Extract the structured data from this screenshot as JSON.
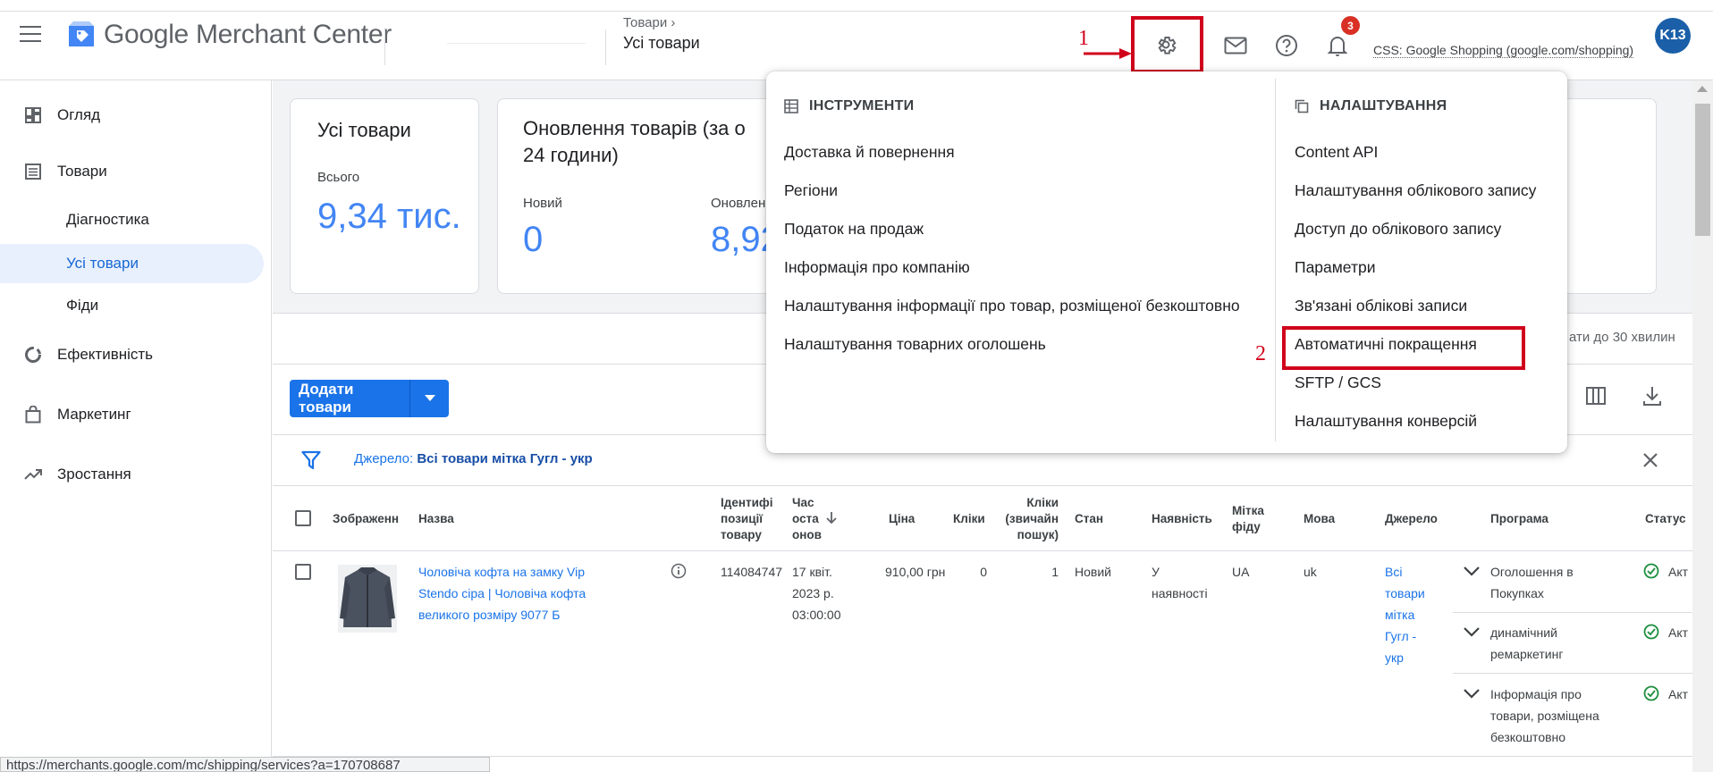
{
  "app": {
    "logo_text": "Google Merchant Center",
    "breadcrumb_parent": "Товари",
    "breadcrumb_current": "Усі товари",
    "notifications_count": "3",
    "css_label": "CSS: Google Shopping (google.com/shopping)",
    "avatar_text": "K13",
    "brand_color": "#1a73e8"
  },
  "annotations": {
    "mark1": "1",
    "mark2": "2",
    "color": "#d0021b"
  },
  "sidebar": {
    "items": [
      {
        "label": "Огляд",
        "icon": "dashboard-icon"
      },
      {
        "label": "Товари",
        "icon": "list-icon"
      },
      {
        "label": "Діагностика"
      },
      {
        "label": "Усі товари",
        "active": true
      },
      {
        "label": "Фіди"
      },
      {
        "label": "Ефективність",
        "icon": "donut-icon"
      },
      {
        "label": "Маркетинг",
        "icon": "shopping-bag-icon"
      },
      {
        "label": "Зростання",
        "icon": "trending-up-icon"
      }
    ]
  },
  "cards": {
    "all_products": {
      "title": "Усі товари",
      "total_label": "Всього",
      "total_value": "9,34 тис."
    },
    "updates": {
      "title": "Оновлення товарів (за о",
      "title_line2": "24 години)",
      "new_label": "Новий",
      "new_value": "0",
      "updated_label": "Оновлен",
      "updated_value": "8,92"
    }
  },
  "toolbar": {
    "add_products": "Додати товари",
    "update_note": "ати до 30 хвилин"
  },
  "filter": {
    "label": "Джерело:",
    "value": "Всі товари мітка Гугл - укр"
  },
  "table": {
    "headers": {
      "image": "Зображенн",
      "name": "Назва",
      "id": [
        "Ідентифі",
        "позиції",
        "товару"
      ],
      "time": [
        "Час",
        "оста",
        "онов"
      ],
      "price": "Ціна",
      "clicks": "Кліки",
      "clicks_organic": [
        "Кліки",
        "(звичайн",
        "пошук)"
      ],
      "condition": "Стан",
      "availability": "Наявність",
      "feed_label": [
        "Мітка",
        "фіду"
      ],
      "language": "Мова",
      "source": "Джерело",
      "program": "Програма",
      "status": "Статус"
    },
    "row": {
      "name": [
        "Чоловіча кофта на замку Vip",
        "Stendo сіра | Чоловіча кофта",
        "великого розміру 9077 Б"
      ],
      "id": "114084747",
      "time": [
        "17 квіт.",
        "2023 р.",
        "03:00:00"
      ],
      "price": "910,00 грн",
      "clicks": "0",
      "clicks_organic": "1",
      "condition": "Новий",
      "availability": [
        "У",
        "наявності"
      ],
      "feed_label": "UA",
      "language": "uk",
      "source": [
        "Всі",
        "товари",
        "мітка",
        "Гугл -",
        "укр"
      ],
      "programs": [
        {
          "name": [
            "Оголошення в",
            "Покупках"
          ],
          "status": "Акт"
        },
        {
          "name": [
            "динамічний",
            "ремаркетинг"
          ],
          "status": "Акт"
        },
        {
          "name": [
            "Інформація про",
            "товари, розміщена",
            "безкоштовно"
          ],
          "status": "Акт"
        }
      ]
    }
  },
  "dropdown": {
    "tools_heading": "ІНСТРУМЕНТИ",
    "tools": [
      "Доставка й повернення",
      "Регіони",
      "Податок на продаж",
      "Інформація про компанію",
      "Налаштування інформації про товар, розміщеної безкоштовно",
      "Налаштування товарних оголошень"
    ],
    "settings_heading": "НАЛАШТУВАННЯ",
    "settings": [
      "Content API",
      "Налаштування облікового запису",
      "Доступ до облікового запису",
      "Параметри",
      "Зв'язані облікові записи",
      "Автоматичні покращення",
      "SFTP / GCS",
      "Налаштування конверсій"
    ]
  },
  "statusbar": {
    "url": "https://merchants.google.com/mc/shipping/services?a=170708687"
  }
}
